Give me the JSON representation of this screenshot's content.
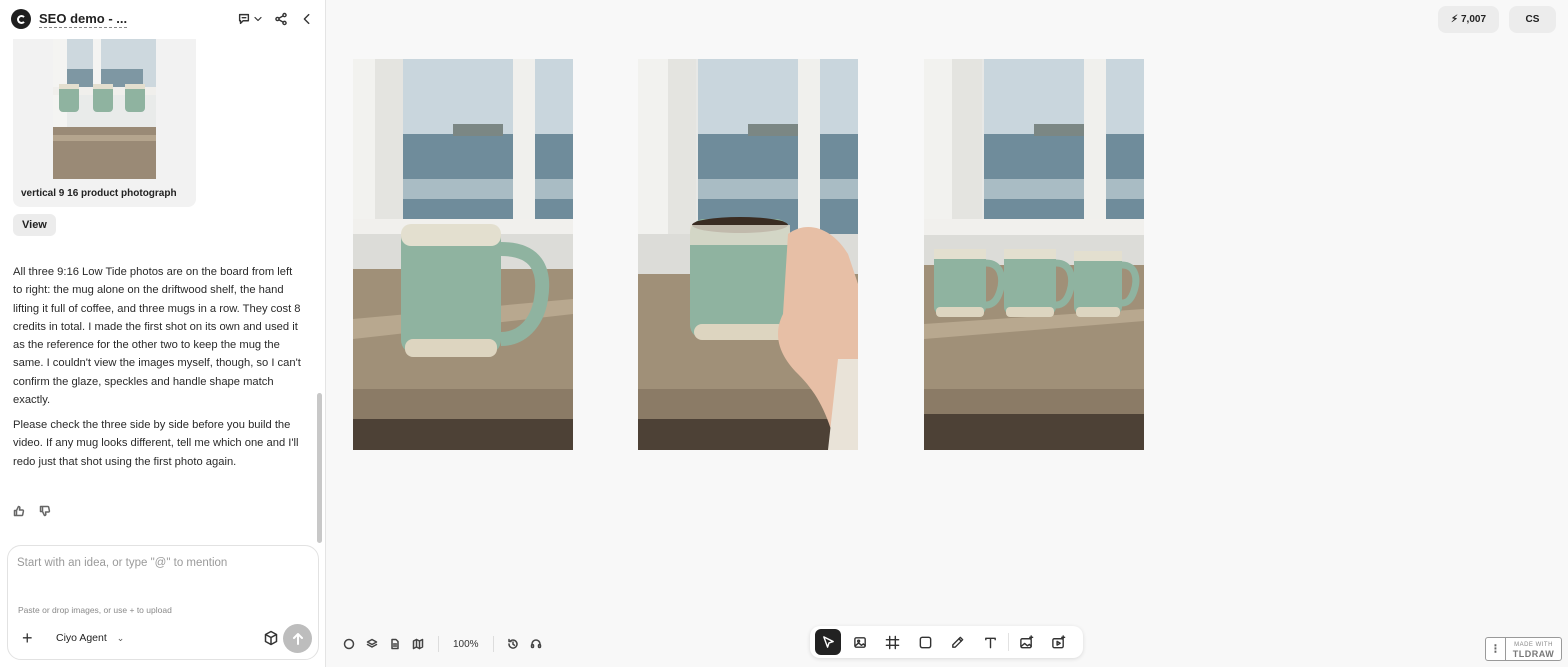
{
  "header": {
    "title": "SEO demo - ..."
  },
  "chat": {
    "image_card": {
      "label": "vertical 9 16 product photograph"
    },
    "view_button": "View",
    "messages": [
      "All three 9:16 Low Tide photos are on the board from left to right: the mug alone on the driftwood shelf, the hand lifting it full of coffee, and three mugs in a row. They cost 8 credits in total. I made the first shot on its own and used it as the reference for the other two to keep the mug the same. I couldn't view the images myself, though, so I can't confirm the glaze, speckles and handle shape match exactly.",
      "Please check the three side by side before you build the video. If any mug looks different, tell me which one and I'll redo just that shot using the first photo again."
    ],
    "feedback": {
      "up_icon": "thumbs-up-icon",
      "down_icon": "thumbs-down-icon"
    }
  },
  "composer": {
    "placeholder": "Start with an idea, or type \"@\" to mention",
    "value": "",
    "hint": "Paste or drop images, or use + to upload",
    "plus_label": "+",
    "agent_label": "Ciyo Agent"
  },
  "top_bar": {
    "credits": "7,007",
    "user_initials": "CS"
  },
  "canvas": {
    "photos": [
      {
        "subject": "single mug on driftwood shelf"
      },
      {
        "subject": "hand lifting mug with coffee"
      },
      {
        "subject": "three mugs in a row"
      }
    ],
    "zoom": "100%"
  },
  "toolbar": {
    "tools": [
      "select-tool",
      "image-tool",
      "frame-tool",
      "rectangle-tool",
      "pencil-tool",
      "text-tool",
      "generate-image-tool",
      "generate-video-tool"
    ]
  },
  "watermark": {
    "line1": "MADE WITH",
    "line2": "TLDRAW"
  },
  "colors": {
    "mug_glaze": "#8fb3a0",
    "wood": "#9a8a76",
    "accent_dark": "#222222"
  }
}
